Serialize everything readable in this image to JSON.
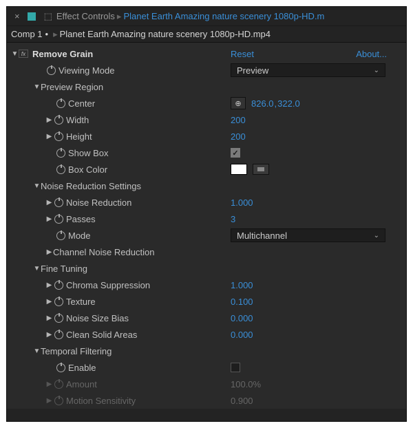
{
  "tab": {
    "panel_label": "Effect Controls",
    "crumb": "Planet Earth  Amazing nature scenery 1080p-HD.m"
  },
  "comp": {
    "name": "Comp 1",
    "bullet": "•",
    "layer": "Planet Earth  Amazing nature scenery 1080p-HD.mp4"
  },
  "effect": {
    "name": "Remove Grain",
    "reset": "Reset",
    "about": "About..."
  },
  "params": {
    "viewing_mode_lbl": "Viewing Mode",
    "viewing_mode_val": "Preview",
    "preview_region_lbl": "Preview Region",
    "center_lbl": "Center",
    "center_x": "826.0",
    "center_y": "322.0",
    "width_lbl": "Width",
    "width_val": "200",
    "height_lbl": "Height",
    "height_val": "200",
    "show_box_lbl": "Show Box",
    "box_color_lbl": "Box Color",
    "nr_settings_lbl": "Noise Reduction Settings",
    "nr_lbl": "Noise Reduction",
    "nr_val": "1.000",
    "passes_lbl": "Passes",
    "passes_val": "3",
    "mode_lbl": "Mode",
    "mode_val": "Multichannel",
    "channel_nr_lbl": "Channel Noise Reduction",
    "fine_tuning_lbl": "Fine Tuning",
    "chroma_lbl": "Chroma Suppression",
    "chroma_val": "1.000",
    "texture_lbl": "Texture",
    "texture_val": "0.100",
    "bias_lbl": "Noise Size Bias",
    "bias_val": "0.000",
    "clean_lbl": "Clean Solid Areas",
    "clean_val": "0.000",
    "temporal_lbl": "Temporal Filtering",
    "enable_lbl": "Enable",
    "amount_lbl": "Amount",
    "amount_val": "100.0%",
    "motion_lbl": "Motion Sensitivity",
    "motion_val": "0.900"
  }
}
